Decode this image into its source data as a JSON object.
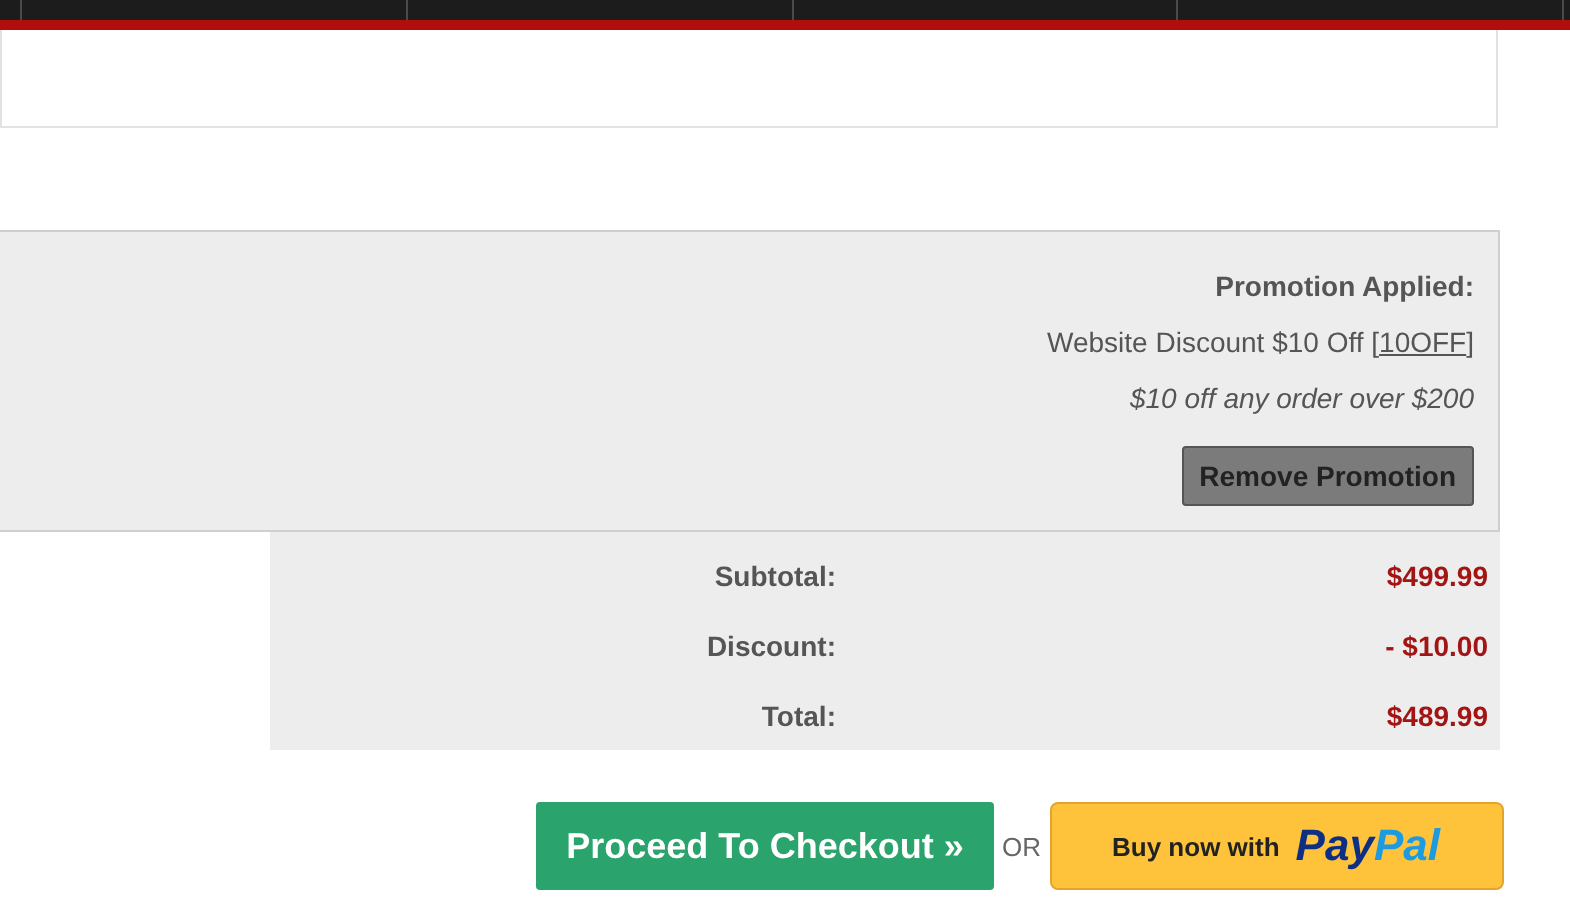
{
  "promotion": {
    "heading": "Promotion Applied:",
    "name": "Website Discount $10 Off [",
    "code": "10OFF",
    "name_end": "]",
    "description": "$10 off any order over $200",
    "remove_button": "Remove Promotion"
  },
  "totals": [
    {
      "label": "Subtotal:",
      "value": "$499.99"
    },
    {
      "label": "Discount:",
      "value": "- $10.00"
    },
    {
      "label": "Total:",
      "value": "$489.99"
    }
  ],
  "checkout_button": "Proceed To Checkout »",
  "separator": "OR",
  "paypal_button": {
    "label": "Buy now with",
    "logo": [
      "Pay",
      "Pal"
    ]
  }
}
